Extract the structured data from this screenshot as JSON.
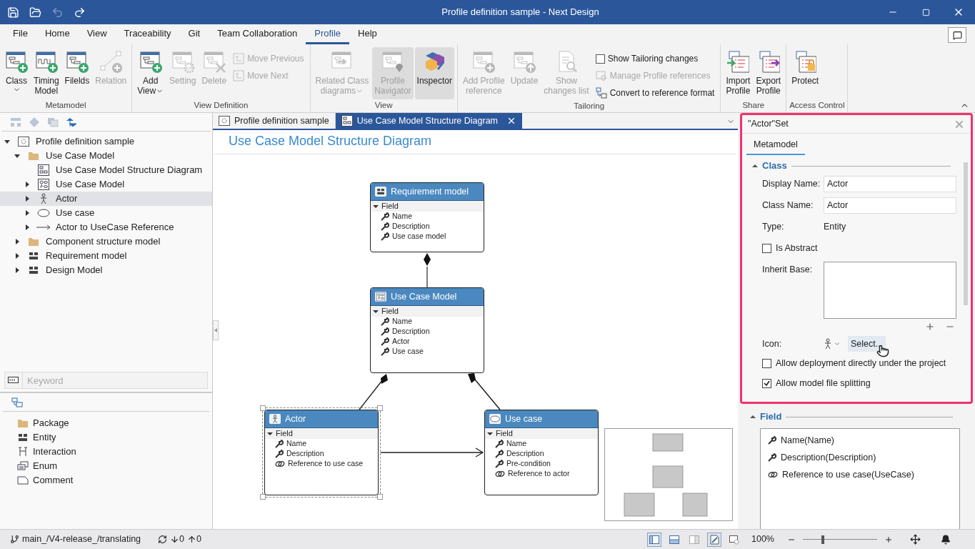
{
  "window": {
    "title": "Profile definition sample - Next Design"
  },
  "quick_access": [
    {
      "kind": "save",
      "disabled": false
    },
    {
      "kind": "open",
      "disabled": false
    },
    {
      "kind": "undo",
      "disabled": true
    },
    {
      "kind": "redo",
      "disabled": false
    }
  ],
  "menu": [
    {
      "label": "File",
      "selected": false
    },
    {
      "label": "Home",
      "selected": false
    },
    {
      "label": "View",
      "selected": false
    },
    {
      "label": "Traceability",
      "selected": false
    },
    {
      "label": "Git",
      "selected": false
    },
    {
      "label": "Team Collaboration",
      "selected": false
    },
    {
      "label": "Profile",
      "selected": true
    },
    {
      "label": "Help",
      "selected": false
    }
  ],
  "ribbon": [
    {
      "title": "Metamodel",
      "items": [
        {
          "kind": "large",
          "lines": [
            "Class"
          ],
          "dropdown": true,
          "disabled": false,
          "selected": false
        },
        {
          "kind": "large",
          "lines": [
            "Timing",
            "Model"
          ],
          "dropdown": false,
          "disabled": false,
          "selected": false
        },
        {
          "kind": "large",
          "lines": [
            "Filelds"
          ],
          "dropdown": false,
          "disabled": false,
          "selected": false
        },
        {
          "kind": "large",
          "lines": [
            "Relation"
          ],
          "dropdown": false,
          "disabled": true,
          "selected": false
        }
      ]
    },
    {
      "title": "View Definition",
      "items": [
        {
          "kind": "large",
          "lines": [
            "Add",
            "View"
          ],
          "dropdown": true,
          "disabled": false,
          "selected": false
        },
        {
          "kind": "large",
          "lines": [
            "Setting"
          ],
          "dropdown": false,
          "disabled": true,
          "selected": false
        },
        {
          "kind": "large",
          "lines": [
            "Delete"
          ],
          "dropdown": false,
          "disabled": true,
          "selected": false
        },
        {
          "kind": "stack",
          "items": [
            {
              "kind": "small",
              "label": "Move Previous",
              "disabled": true
            },
            {
              "kind": "small",
              "label": "Move Next",
              "disabled": true
            }
          ]
        }
      ]
    },
    {
      "title": "View",
      "items": [
        {
          "kind": "large",
          "lines": [
            "Related Class",
            "diagrams"
          ],
          "dropdown": true,
          "disabled": true,
          "selected": false
        },
        {
          "kind": "large",
          "lines": [
            "Profile",
            "Navigator"
          ],
          "dropdown": false,
          "disabled": true,
          "selected": true
        },
        {
          "kind": "large",
          "lines": [
            "Inspector"
          ],
          "dropdown": false,
          "disabled": false,
          "selected": true
        }
      ]
    },
    {
      "title": "Tailoring",
      "items": [
        {
          "kind": "large",
          "lines": [
            "Add Profile",
            "reference"
          ],
          "dropdown": false,
          "disabled": true,
          "selected": false
        },
        {
          "kind": "large",
          "lines": [
            "Update"
          ],
          "dropdown": false,
          "disabled": true,
          "selected": false
        },
        {
          "kind": "large",
          "lines": [
            "Show",
            "changes list"
          ],
          "dropdown": false,
          "disabled": true,
          "selected": false
        },
        {
          "kind": "stack",
          "items": [
            {
              "kind": "check",
              "label": "Show Tailoring changes",
              "checked": false
            },
            {
              "kind": "small",
              "label": "Manage Profile references",
              "disabled": true
            },
            {
              "kind": "small",
              "label": "Convert to reference format",
              "disabled": false
            }
          ]
        }
      ]
    },
    {
      "title": "Share",
      "items": [
        {
          "kind": "large",
          "lines": [
            "Import",
            "Profile"
          ],
          "dropdown": false,
          "disabled": false,
          "selected": false
        },
        {
          "kind": "large",
          "lines": [
            "Export",
            "Profile"
          ],
          "dropdown": false,
          "disabled": false,
          "selected": false
        }
      ]
    },
    {
      "title": "Access Control",
      "items": [
        {
          "kind": "large",
          "lines": [
            "Protect"
          ],
          "dropdown": false,
          "disabled": false,
          "selected": false
        }
      ]
    }
  ],
  "left_toolbar": [
    {
      "kind": "layout",
      "disabled": true
    },
    {
      "kind": "diamond",
      "disabled": true
    },
    {
      "kind": "copy",
      "disabled": true
    },
    {
      "kind": "sort",
      "disabled": false
    }
  ],
  "tree": [
    {
      "label": "Profile definition sample",
      "kind": "profile",
      "expanded": true,
      "selected": false,
      "children": [
        {
          "label": "Use Case Model",
          "kind": "package",
          "expanded": true,
          "selected": false,
          "children": [
            {
              "label": "Use Case Model Structure Diagram",
              "kind": "diagram",
              "selected": false
            },
            {
              "label": "Use Case Model",
              "kind": "usecase-model",
              "expanded": false,
              "selected": false
            },
            {
              "label": "Actor",
              "kind": "actor",
              "expanded": false,
              "selected": true
            },
            {
              "label": "Use case",
              "kind": "ellipse",
              "expanded": false,
              "selected": false
            },
            {
              "label": "Actor to UseCase Reference",
              "kind": "arrow",
              "expanded": false,
              "selected": false
            }
          ]
        },
        {
          "label": "Component structure model",
          "kind": "package",
          "expanded": false,
          "selected": false
        },
        {
          "label": "Requirement model",
          "kind": "entity",
          "expanded": false,
          "selected": false
        },
        {
          "label": "Design Model",
          "kind": "entity",
          "expanded": false,
          "selected": false
        }
      ]
    }
  ],
  "search": {
    "placeholder": "Keyword"
  },
  "palette": [
    {
      "label": "Package",
      "kind": "package"
    },
    {
      "label": "Entity",
      "kind": "entity"
    },
    {
      "label": "Interaction",
      "kind": "interaction"
    },
    {
      "label": "Enum",
      "kind": "enum"
    },
    {
      "label": "Comment",
      "kind": "comment"
    }
  ],
  "doc_tabs": [
    {
      "label": "Profile definition sample",
      "kind": "profile",
      "selected": false
    },
    {
      "label": "Use Case Model Structure Diagram",
      "kind": "diagram",
      "selected": true
    }
  ],
  "diagram": {
    "title": "Use Case Model Structure Diagram",
    "nodes": [
      {
        "title": "Requirement model",
        "kind": "entity",
        "selected": false,
        "section": "Field",
        "fields": [
          {
            "label": "Name",
            "kind": "attribute"
          },
          {
            "label": "Description",
            "kind": "attribute"
          },
          {
            "label": "Use case model",
            "kind": "attribute"
          }
        ]
      },
      {
        "title": "Use Case Model",
        "kind": "usecase-model",
        "selected": false,
        "section": "Field",
        "fields": [
          {
            "label": "Name",
            "kind": "attribute"
          },
          {
            "label": "Description",
            "kind": "attribute"
          },
          {
            "label": "Actor",
            "kind": "attribute"
          },
          {
            "label": "Use case",
            "kind": "attribute"
          }
        ]
      },
      {
        "title": "Actor",
        "kind": "actor",
        "selected": true,
        "section": "Field",
        "fields": [
          {
            "label": "Name",
            "kind": "attribute"
          },
          {
            "label": "Description",
            "kind": "attribute"
          },
          {
            "label": "Reference to use case",
            "kind": "reference"
          }
        ]
      },
      {
        "title": "Use case",
        "kind": "ellipse",
        "selected": false,
        "section": "Field",
        "fields": [
          {
            "label": "Name",
            "kind": "attribute"
          },
          {
            "label": "Description",
            "kind": "attribute"
          },
          {
            "label": "Pre-condition",
            "kind": "attribute"
          },
          {
            "label": "Reference to actor",
            "kind": "reference"
          }
        ]
      }
    ]
  },
  "inspector": {
    "title": "\"Actor\"Set",
    "tabs": [
      {
        "label": "Metamodel",
        "selected": true
      }
    ],
    "class_section": {
      "title": "Class",
      "expanded": true,
      "display_name": {
        "label": "Display Name:",
        "value": "Actor"
      },
      "class_name": {
        "label": "Class Name:",
        "value": "Actor"
      },
      "type": {
        "label": "Type:",
        "value": "Entity"
      },
      "is_abstract": {
        "label": "Is Abstract",
        "checked": false
      },
      "inherit_base": {
        "label": "Inherit Base:"
      },
      "icon": {
        "label": "Icon:",
        "button": "Select..."
      },
      "options": [
        {
          "label": "Allow deployment directly under the project",
          "checked": false
        },
        {
          "label": "Allow model file splitting",
          "checked": true
        }
      ]
    },
    "field_section": {
      "title": "Field",
      "expanded": true,
      "items": [
        {
          "label": "Name(Name)",
          "kind": "attribute"
        },
        {
          "label": "Description(Description)",
          "kind": "attribute"
        },
        {
          "label": "Reference to use case(UseCase)",
          "kind": "reference"
        }
      ]
    }
  },
  "status_bar": {
    "branch": "main_/V4-release_/translating",
    "incoming": "0",
    "outgoing": "0",
    "view_buttons": [
      {
        "kind": "left-pane",
        "selected": true
      },
      {
        "kind": "bottom-pane",
        "selected": false
      },
      {
        "kind": "right-pane",
        "selected": false
      },
      {
        "kind": "tailoring",
        "selected": true
      },
      {
        "kind": "settings",
        "selected": false
      }
    ],
    "zoom": "100%",
    "zoom_level": {
      "level": 0.27
    }
  }
}
